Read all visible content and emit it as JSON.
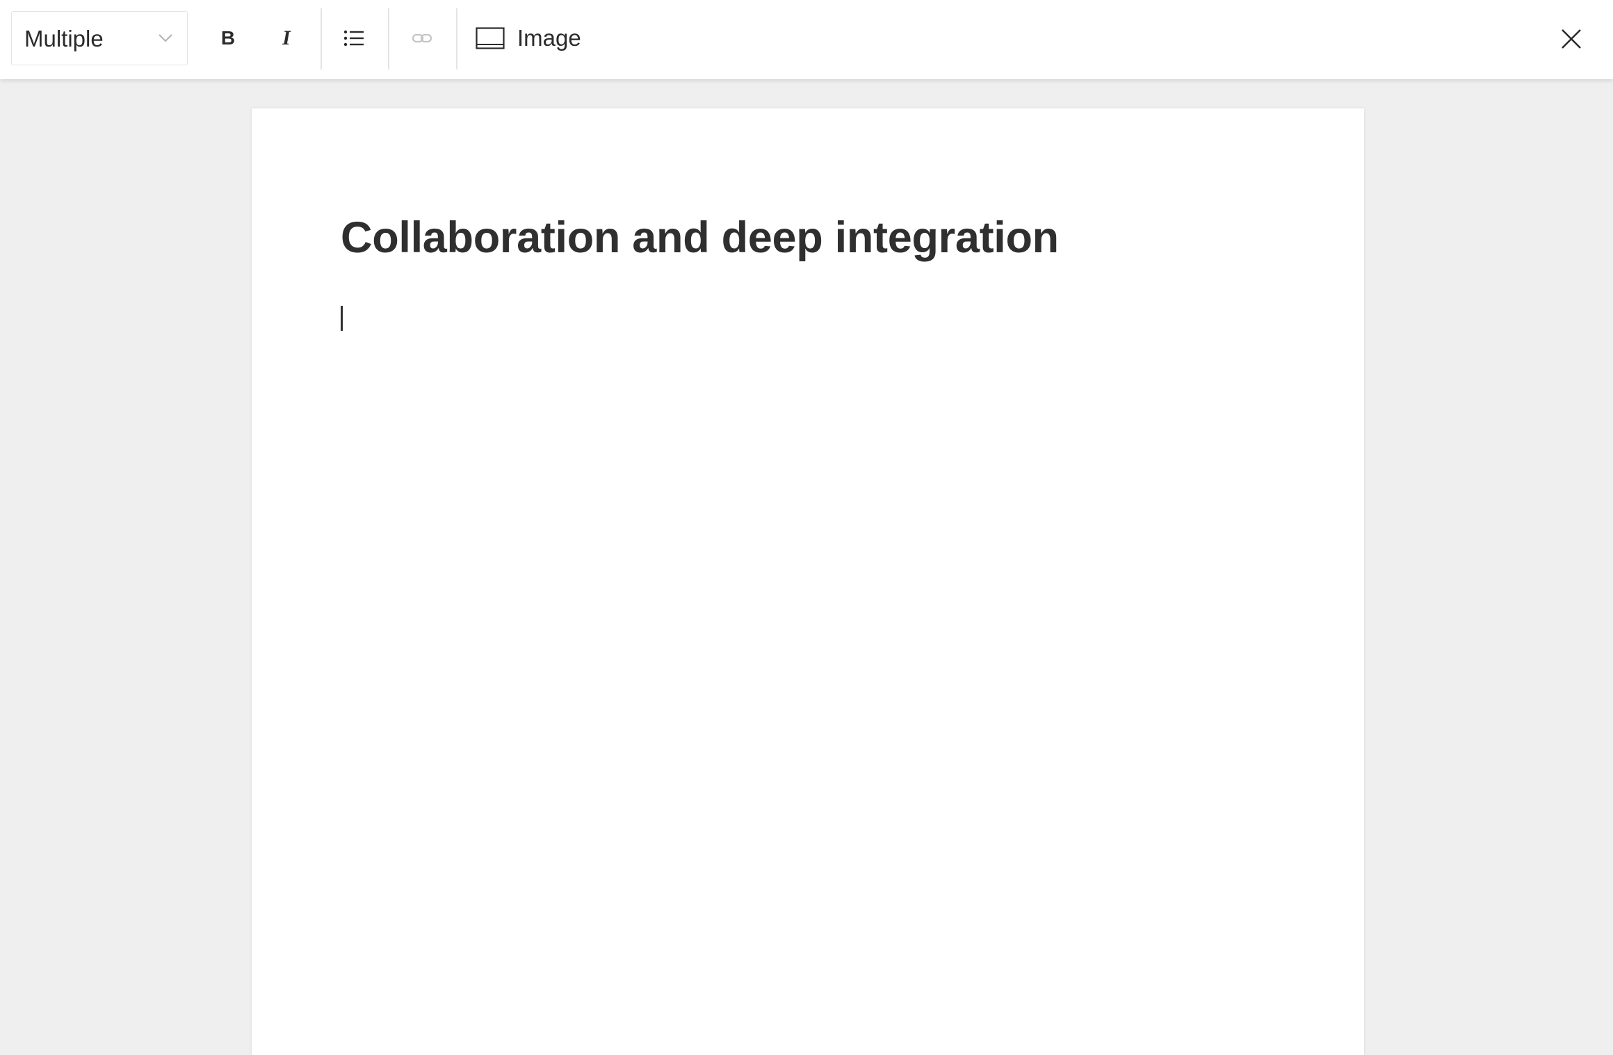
{
  "toolbar": {
    "heading_select": {
      "value": "Multiple"
    },
    "bold_label": "B",
    "italic_label": "I",
    "image_label": "Image",
    "icons": {
      "dropdown": "chevron-down-icon",
      "bulleted_list": "bulleted-list-icon",
      "link": "link-icon",
      "image": "image-icon",
      "close": "close-icon"
    }
  },
  "document": {
    "title": "Collaboration and deep integration",
    "body": ""
  },
  "colors": {
    "text": "#2f2f2f",
    "background": "#efefef",
    "toolbar": "#ffffff",
    "disabled_icon": "#c4c4c4"
  }
}
